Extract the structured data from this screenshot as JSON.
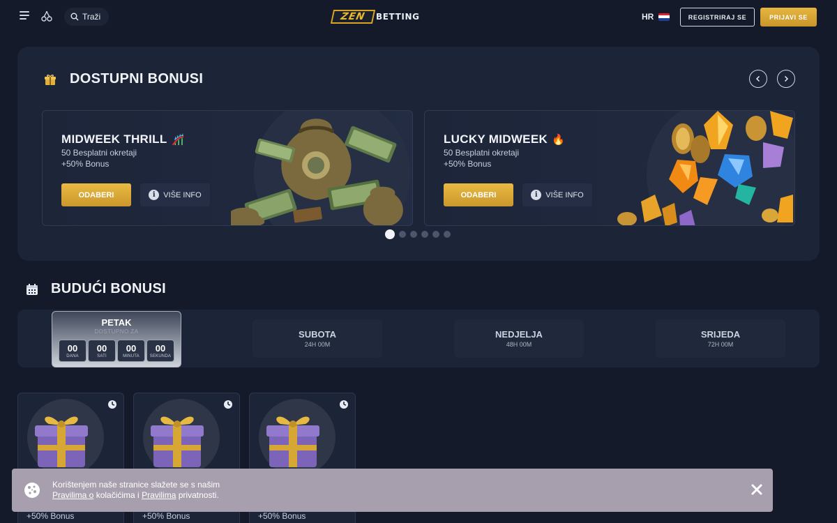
{
  "header": {
    "search_label": "Traži",
    "logo_mark": "ZEN",
    "logo_text": "BETTING",
    "language": "HR",
    "register_label": "REGISTRIRAJ SE",
    "login_label": "PRIJAVI SE"
  },
  "available": {
    "title": "DOSTUPNI BONUSI",
    "cards": [
      {
        "title": "MIDWEEK THRILL",
        "emoji": "🎢",
        "line1": "50 Besplatni okretaji",
        "line2": "+50% Bonus",
        "choose": "ODABERI",
        "info": "VIŠE INFO"
      },
      {
        "title": "LUCKY MIDWEEK",
        "emoji": "🔥",
        "line1": "50 Besplatni okretaji",
        "line2": "+50% Bonus",
        "choose": "ODABERI",
        "info": "VIŠE INFO"
      }
    ],
    "slides_total": 6,
    "active_slide": 1
  },
  "upcoming": {
    "title": "BUDUĆI BONUSI",
    "active_day": {
      "name": "PETAK",
      "subtitle": "DOSTUPNO ZA",
      "countdown": [
        {
          "value": "00",
          "unit": "DANA"
        },
        {
          "value": "00",
          "unit": "SATI"
        },
        {
          "value": "00",
          "unit": "MINUTA"
        },
        {
          "value": "00",
          "unit": "SEKUNDA"
        }
      ]
    },
    "days": [
      {
        "name": "SUBOTA",
        "sub": "24H 00M"
      },
      {
        "name": "NEDJELJA",
        "sub": "48H 00M"
      },
      {
        "name": "SRIJEDA",
        "sub": "72H 00M"
      }
    ]
  },
  "gift_cards": [
    {
      "line": "+50% Bonus"
    },
    {
      "line": "+50% Bonus"
    },
    {
      "line": "+50% Bonus"
    }
  ],
  "cookie": {
    "text1": "Korištenjem naše stranice slažete se s našim",
    "link1": "Pravilima o",
    "text2": "kolačićima i",
    "link2": "Pravilima",
    "text3": "privatnosti."
  },
  "colors": {
    "background": "#141a29",
    "panel": "#1c2438",
    "accent_gold": "#e6b640",
    "cookie_bar": "#a79fae"
  },
  "icons": [
    "menu-icon",
    "cherry-icon",
    "search-icon",
    "flag-hr-icon",
    "gift-icon",
    "chevron-left-icon",
    "chevron-right-icon",
    "info-icon",
    "calendar-icon",
    "timer-icon",
    "cookie-icon",
    "close-icon"
  ]
}
